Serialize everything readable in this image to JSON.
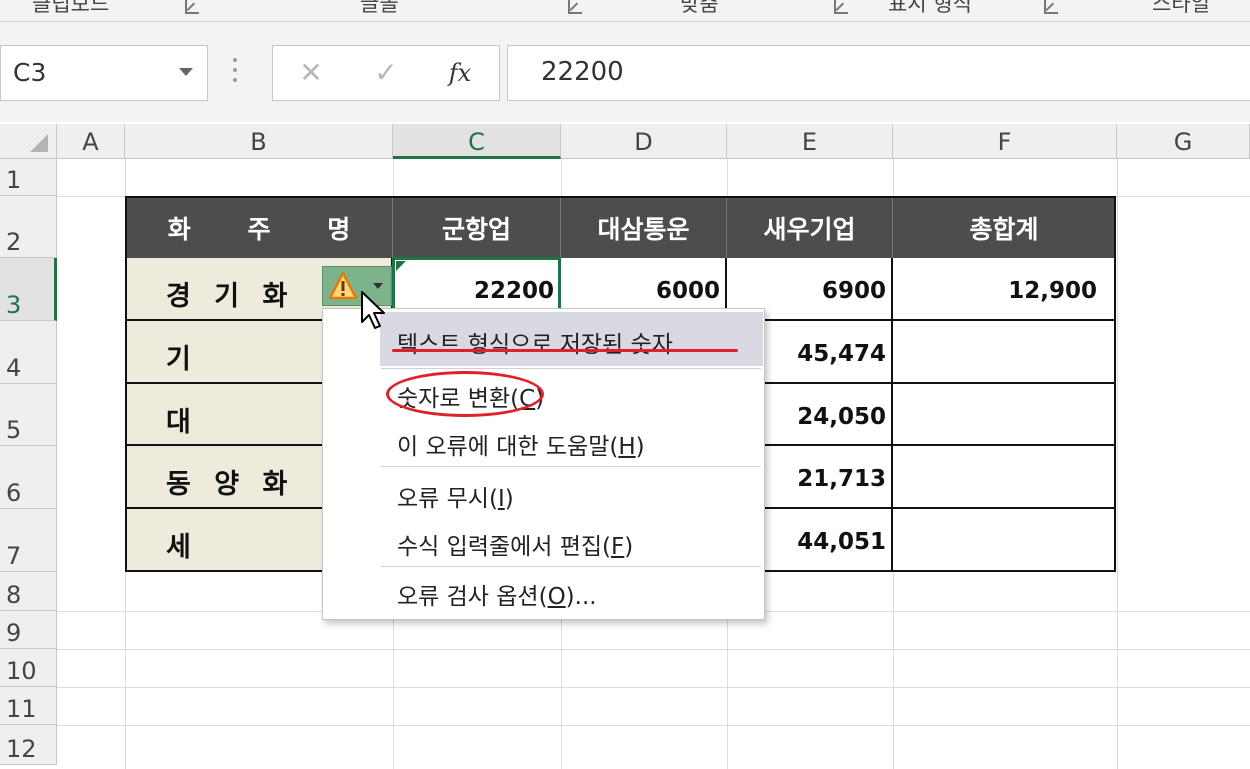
{
  "ribbon": {
    "groups": [
      "클립보드",
      "글꼴",
      "맞춤",
      "표시 형식",
      "스타일"
    ]
  },
  "formula_bar": {
    "name_box": "C3",
    "cancel_symbol": "✕",
    "enter_symbol": "✓",
    "fx_symbol": "fx",
    "value": "22200"
  },
  "grid": {
    "columns": [
      "A",
      "B",
      "C",
      "D",
      "E",
      "F",
      "G"
    ],
    "selected_column": "C",
    "rows": [
      "1",
      "2",
      "3",
      "4",
      "5",
      "6",
      "7",
      "8",
      "9",
      "10",
      "11",
      "12"
    ],
    "selected_row": "3"
  },
  "table": {
    "headers": [
      "화 주 명",
      "군항업",
      "대삼통운",
      "새우기업",
      "총합계"
    ],
    "rows": [
      {
        "name": "경 기 화",
        "c": "22200",
        "d": "6000",
        "e": "6900",
        "total": "12,900"
      },
      {
        "name": "기",
        "c": "",
        "d": "",
        "e": "45,474",
        "total": ""
      },
      {
        "name": "대",
        "c": "",
        "d": "",
        "e": "24,050",
        "total": ""
      },
      {
        "name": "동 양 화",
        "c": "",
        "d": "",
        "e": "21,713",
        "total": ""
      },
      {
        "name": "세",
        "c": "",
        "d": "",
        "e": "44,051",
        "total": ""
      }
    ]
  },
  "error_menu": {
    "header": "텍스트 형식으로 저장된 숫자",
    "items": [
      {
        "label": "숫자로 변환(",
        "key": "C",
        "suffix": ")"
      },
      {
        "label": "이 오류에 대한 도움말(",
        "key": "H",
        "suffix": ")"
      },
      {
        "label": "오류 무시(",
        "key": "I",
        "suffix": ")"
      },
      {
        "label": "수식 입력줄에서 편집(",
        "key": "F",
        "suffix": ")"
      },
      {
        "label": "오류 검사 옵션(",
        "key": "O",
        "suffix": ")..."
      }
    ]
  },
  "colors": {
    "excel_green": "#217346",
    "header_fill": "#4d4d4d",
    "name_fill": "#eeeadc",
    "highlight_red": "#e0202a",
    "warning_orange": "#f29a1e"
  }
}
